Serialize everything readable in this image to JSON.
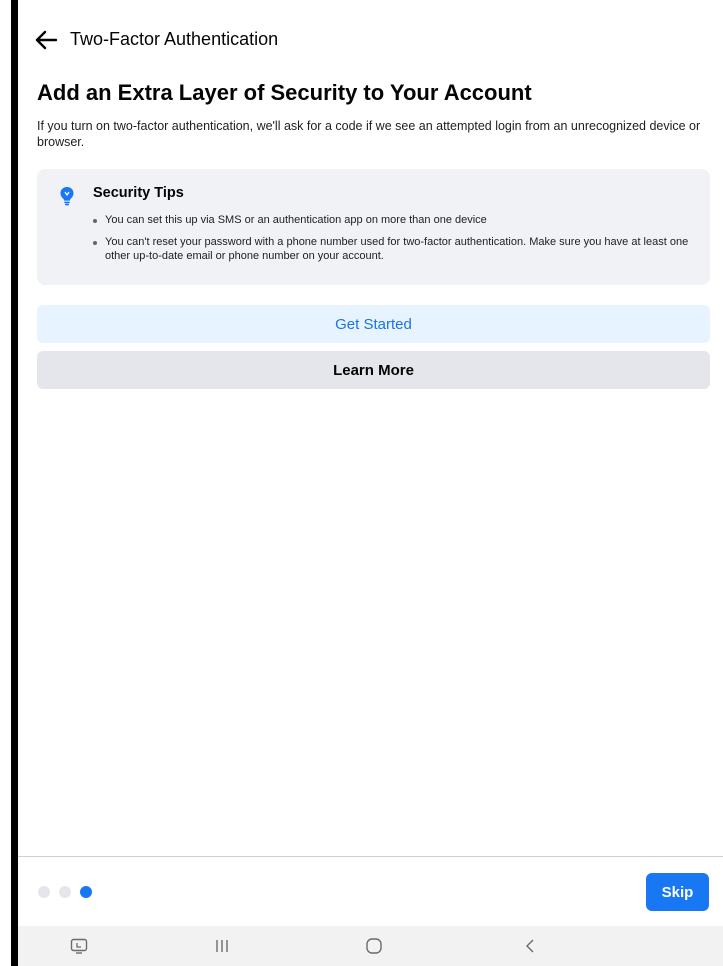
{
  "header": {
    "title": "Two-Factor Authentication",
    "back_icon": "arrow-left-icon"
  },
  "main": {
    "title": "Add an Extra Layer of Security to Your Account",
    "description": "If you turn on two-factor authentication, we'll ask for a code if we see an attempted login from an unrecognized device or browser.",
    "tips": {
      "icon": "lightbulb-icon",
      "title": "Security Tips",
      "items": [
        "You can set this up via SMS or an authentication app on more than one device",
        "You can't reset your password with a phone number used for two-factor authentication. Make sure you have at least one other up-to-date email or phone number on your account."
      ]
    },
    "get_started_label": "Get Started",
    "learn_more_label": "Learn More"
  },
  "footer": {
    "page_count": 3,
    "active_page": 3,
    "skip_label": "Skip"
  },
  "colors": {
    "accent": "#1877f2",
    "accent_light": "#e7f3ff",
    "secondary_button": "#e4e6eb",
    "card_background": "#f0f2f5"
  }
}
